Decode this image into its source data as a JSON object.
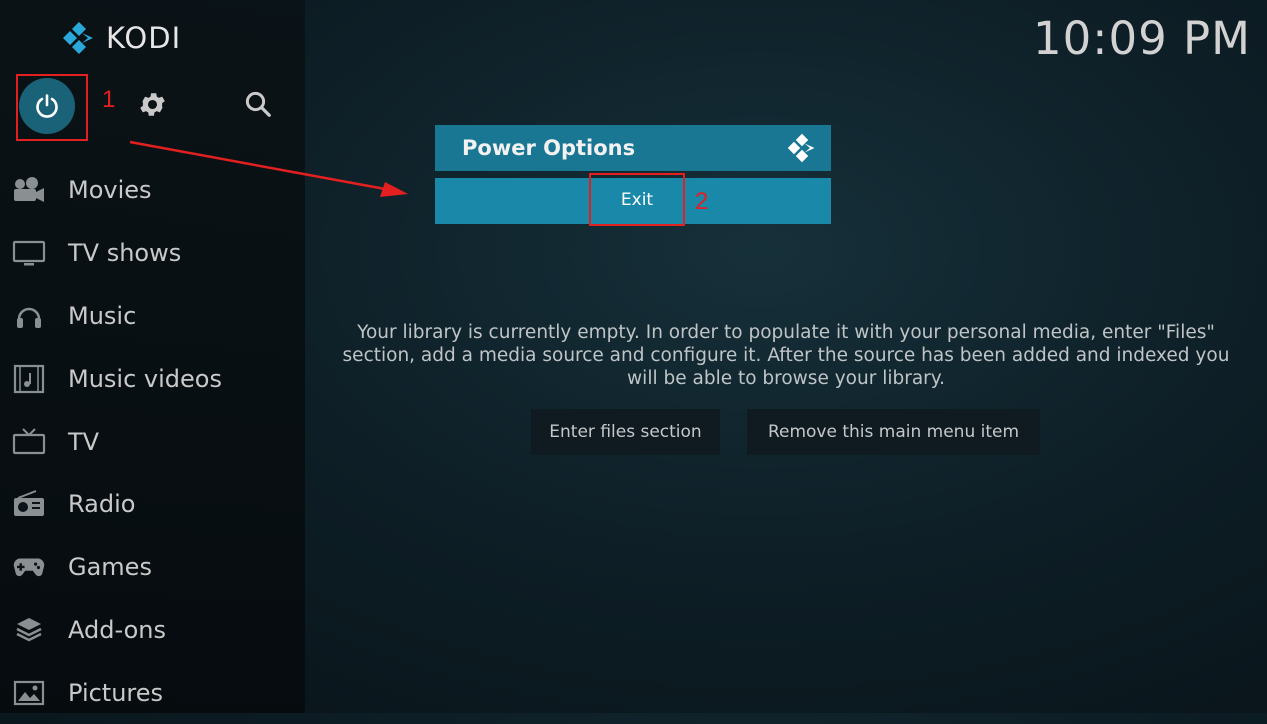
{
  "app": {
    "logo_text": "KODI"
  },
  "clock": {
    "time": "10:09 PM"
  },
  "toolbar": {
    "power_icon": "power-icon",
    "settings_icon": "gear-icon",
    "search_icon": "search-icon"
  },
  "sidebar": {
    "items": [
      {
        "label": "Movies",
        "icon": "movies-icon"
      },
      {
        "label": "TV shows",
        "icon": "tv-shows-icon"
      },
      {
        "label": "Music",
        "icon": "headphones-icon"
      },
      {
        "label": "Music videos",
        "icon": "music-videos-icon"
      },
      {
        "label": "TV",
        "icon": "tv-icon"
      },
      {
        "label": "Radio",
        "icon": "radio-icon"
      },
      {
        "label": "Games",
        "icon": "gamepad-icon"
      },
      {
        "label": "Add-ons",
        "icon": "addons-icon"
      },
      {
        "label": "Pictures",
        "icon": "pictures-icon"
      }
    ]
  },
  "dialog": {
    "title": "Power Options",
    "exit_label": "Exit"
  },
  "main": {
    "message": "Your library is currently empty. In order to populate it with your personal media, enter \"Files\" section, add a media source and configure it. After the source has been added and indexed you will be able to browse your library.",
    "enter_files_label": "Enter files section",
    "remove_item_label": "Remove this main menu item"
  },
  "annotations": {
    "step1": "1",
    "step2": "2"
  },
  "colors": {
    "accent": "#1a88a8",
    "highlight": "#e32020"
  }
}
